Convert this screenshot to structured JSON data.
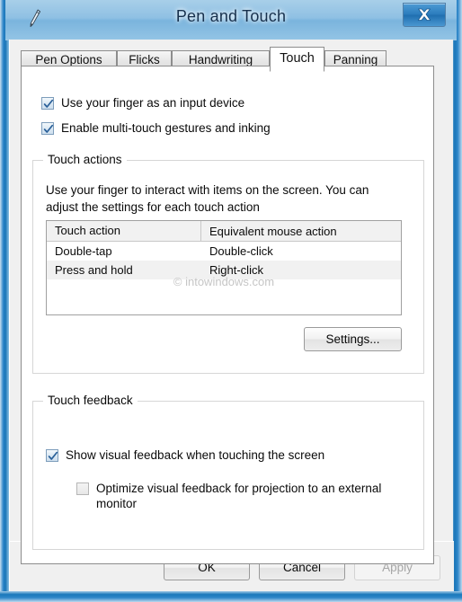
{
  "window": {
    "title": "Pen and Touch",
    "app_icon": "pen-icon",
    "close_label": "X"
  },
  "tabs": [
    {
      "label": "Pen Options",
      "selected": false
    },
    {
      "label": "Flicks",
      "selected": false
    },
    {
      "label": "Handwriting",
      "selected": false
    },
    {
      "label": "Touch",
      "selected": true
    },
    {
      "label": "Panning",
      "selected": false
    }
  ],
  "checkboxes": {
    "use_finger": {
      "label": "Use your finger as an input device",
      "checked": true
    },
    "multi_touch": {
      "label": "Enable multi-touch gestures and inking",
      "checked": true
    }
  },
  "touch_actions_group": {
    "title": "Touch actions",
    "description": "Use your finger to interact with items on the screen. You can adjust the settings for each touch action",
    "settings_button": "Settings..."
  },
  "touch_actions_table": {
    "columns": [
      "Touch action",
      "Equivalent mouse action"
    ],
    "rows": [
      [
        "Double-tap",
        "Double-click"
      ],
      [
        "Press and hold",
        "Right-click"
      ]
    ],
    "watermark": "© intowindows.com"
  },
  "touch_feedback_group": {
    "title": "Touch feedback",
    "show_visual_feedback": {
      "label": "Show visual feedback when touching the screen",
      "checked": true
    },
    "optimize_projection": {
      "label": "Optimize visual feedback for projection to an external monitor",
      "checked": false,
      "enabled": false
    }
  },
  "footer": {
    "ok": "OK",
    "cancel": "Cancel",
    "apply": "Apply",
    "apply_enabled": false
  },
  "colors": {
    "titlebar_text": "#16304d",
    "dialog_bg": "#f0f0f0",
    "page_bg": "#ffffff",
    "checkbox_accent": "#2a6099",
    "watermark": "#c6c6c6",
    "frame_blue": "#2f87c9"
  }
}
